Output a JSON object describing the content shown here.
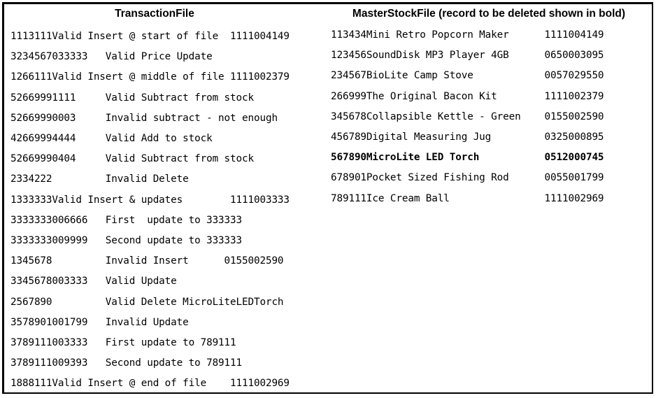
{
  "left_panel": {
    "title": "TransactionFile",
    "records": [
      "1113111Valid Insert @ start of file  1111004149",
      "3234567033333   Valid Price Update",
      "1266111Valid Insert @ middle of file 1111002379",
      "52669991111     Valid Subtract from stock",
      "52669990003     Invalid subtract - not enough",
      "42669994444     Valid Add to stock",
      "52669990404     Valid Subtract from stock",
      "2334222         Invalid Delete",
      "1333333Valid Insert & updates        1111003333",
      "3333333006666   First  update to 333333",
      "3333333009999   Second update to 333333",
      "1345678         Invalid Insert      0155002590",
      "3345678003333   Valid Update",
      "2567890         Valid Delete MicroLiteLEDTorch",
      "3578901001799   Invalid Update",
      "3789111003333   First update to 789111",
      "3789111009393   Second update to 789111",
      "1888111Valid Insert @ end of file    1111002969"
    ]
  },
  "right_panel": {
    "title": "MasterStockFile (record to be deleted shown in bold)",
    "records": [
      {
        "text": "113434Mini Retro Popcorn Maker      1111004149",
        "bold": false
      },
      {
        "text": "123456SoundDisk MP3 Player 4GB      0650003095",
        "bold": false
      },
      {
        "text": "234567BioLite Camp Stove            0057029550",
        "bold": false
      },
      {
        "text": "266999The Original Bacon Kit        1111002379",
        "bold": false
      },
      {
        "text": "345678Collapsible Kettle - Green    0155002590",
        "bold": false
      },
      {
        "text": "456789Digital Measuring Jug         0325000895",
        "bold": false
      },
      {
        "text": "567890MicroLite LED Torch           0512000745",
        "bold": true
      },
      {
        "text": "678901Pocket Sized Fishing Rod      0055001799",
        "bold": false
      },
      {
        "text": "789111Ice Cream Ball                1111002969",
        "bold": false
      }
    ]
  },
  "style": {
    "border_color": "#000000",
    "text_color": "#000000",
    "background_color": "#ffffff"
  }
}
